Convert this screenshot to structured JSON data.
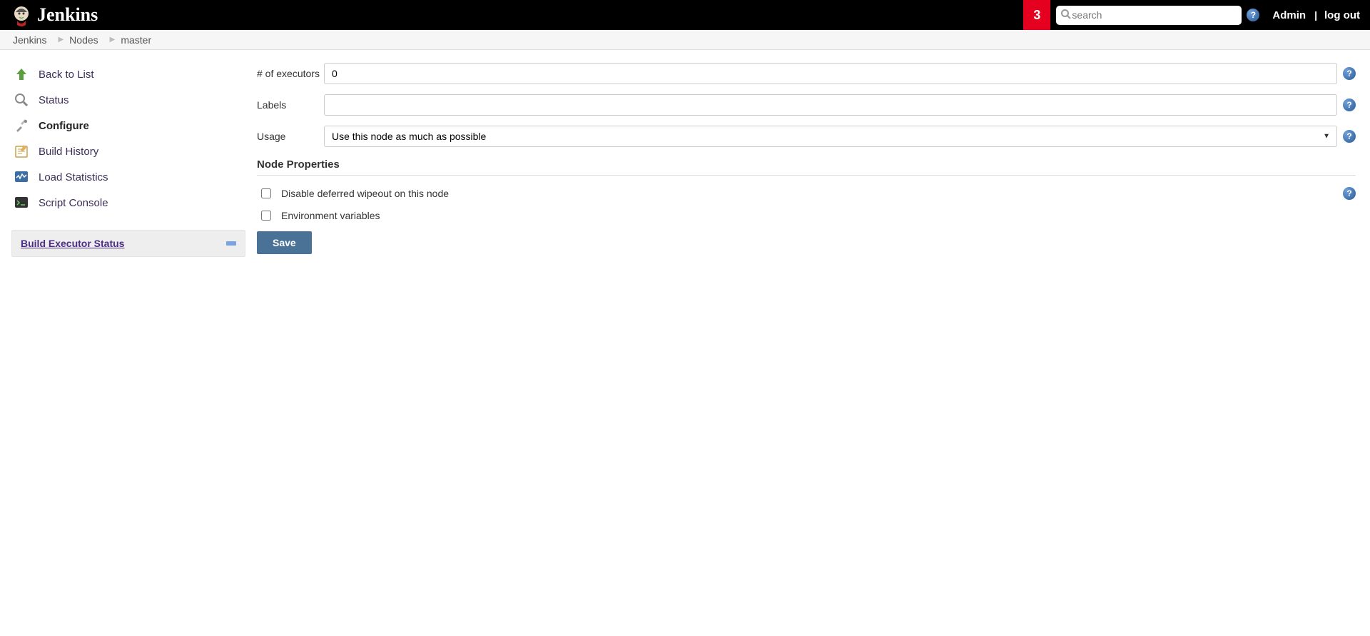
{
  "header": {
    "brand": "Jenkins",
    "notifications": "3",
    "search_placeholder": "search",
    "user": "Admin",
    "logout": "log out"
  },
  "breadcrumb": {
    "items": [
      "Jenkins",
      "Nodes",
      "master"
    ]
  },
  "sidebar": {
    "tasks": [
      {
        "label": "Back to List"
      },
      {
        "label": "Status"
      },
      {
        "label": "Configure"
      },
      {
        "label": "Build History"
      },
      {
        "label": "Load Statistics"
      },
      {
        "label": "Script Console"
      }
    ],
    "executor_title": "Build Executor Status"
  },
  "form": {
    "executors_label": "# of executors",
    "executors_value": "0",
    "labels_label": "Labels",
    "labels_value": "",
    "usage_label": "Usage",
    "usage_value": "Use this node as much as possible",
    "section": "Node Properties",
    "chk1": "Disable deferred wipeout on this node",
    "chk2": "Environment variables",
    "save": "Save"
  }
}
